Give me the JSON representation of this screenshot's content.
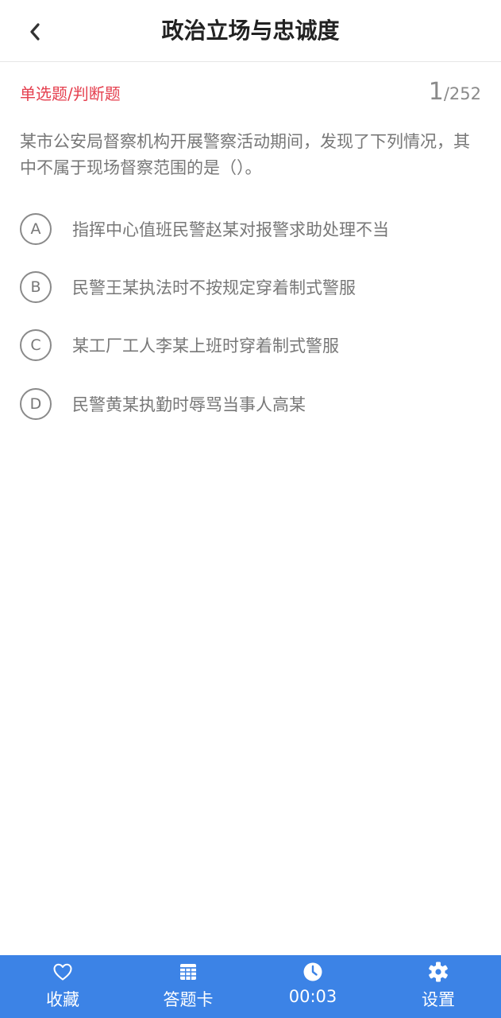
{
  "header": {
    "title": "政治立场与忠诚度",
    "back_icon": "chevron-left-icon"
  },
  "question": {
    "type_label": "单选题/判断题",
    "current": "1",
    "total": "/252",
    "text": "某市公安局督察机构开展警察活动期间，发现了下列情况，其中不属于现场督察范围的是（）。",
    "options": [
      {
        "letter": "A",
        "text": "指挥中心值班民警赵某对报警求助处理不当"
      },
      {
        "letter": "B",
        "text": "民警王某执法时不按规定穿着制式警服"
      },
      {
        "letter": "C",
        "text": "某工厂工人李某上班时穿着制式警服"
      },
      {
        "letter": "D",
        "text": "民警黄某执勤时辱骂当事人高某"
      }
    ]
  },
  "bottom_bar": {
    "tabs": [
      {
        "label": "收藏",
        "icon": "heart-icon"
      },
      {
        "label": "答题卡",
        "icon": "grid-icon"
      },
      {
        "label": "00:03",
        "icon": "clock-icon"
      },
      {
        "label": "设置",
        "icon": "gear-icon"
      }
    ]
  },
  "colors": {
    "accent_red": "#e5404f",
    "bar_blue": "#3c83e6",
    "text_gray": "#777777"
  }
}
